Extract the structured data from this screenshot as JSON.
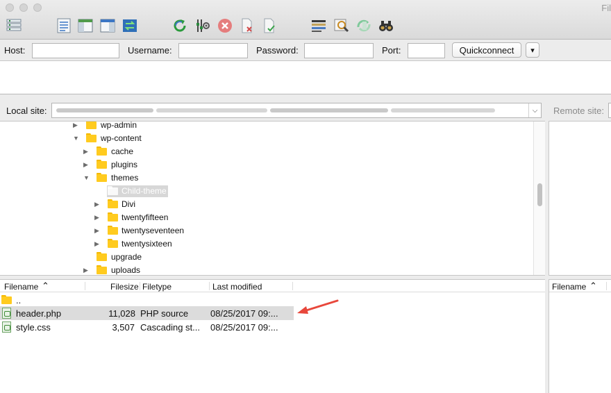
{
  "window": {
    "title": "Fil"
  },
  "toolbar": {
    "icons": [
      "site-manager-icon",
      "toggle-message-log-icon",
      "toggle-local-tree-icon",
      "toggle-remote-tree-icon",
      "toggle-queue-icon",
      "refresh-icon",
      "process-queue-icon",
      "cancel-icon",
      "disconnect-icon",
      "reconnect-icon",
      "filename-filters-icon",
      "compare-directories-icon",
      "sync-browsing-icon",
      "search-files-icon"
    ]
  },
  "quickconnect": {
    "host_label": "Host:",
    "username_label": "Username:",
    "password_label": "Password:",
    "port_label": "Port:",
    "host_value": "",
    "username_value": "",
    "password_value": "",
    "port_value": "",
    "button_label": "Quickconnect",
    "dropdown_glyph": "▾"
  },
  "local": {
    "label": "Local site:",
    "combo_arrow": "⌵"
  },
  "remote": {
    "label": "Remote site:"
  },
  "tree": {
    "items": [
      {
        "label": "wp-admin",
        "expander": "▶"
      },
      {
        "label": "wp-content",
        "expander": "▼"
      },
      {
        "label": "cache",
        "expander": "▶"
      },
      {
        "label": "plugins",
        "expander": "▶"
      },
      {
        "label": "themes",
        "expander": "▼"
      },
      {
        "label": "Child-theme",
        "expander": "",
        "selected": true
      },
      {
        "label": "Divi",
        "expander": "▶"
      },
      {
        "label": "twentyfifteen",
        "expander": "▶"
      },
      {
        "label": "twentyseventeen",
        "expander": "▶"
      },
      {
        "label": "twentysixteen",
        "expander": "▶"
      },
      {
        "label": "upgrade",
        "expander": ""
      },
      {
        "label": "uploads",
        "expander": "▶"
      }
    ]
  },
  "filelist": {
    "columns": {
      "filename": "Filename",
      "sort_glyph": "⌃",
      "filesize": "Filesize",
      "filetype": "Filetype",
      "last_modified": "Last modified"
    },
    "rows": [
      {
        "filename": "..",
        "filesize": "",
        "filetype": "",
        "last_modified": ""
      },
      {
        "filename": "header.php",
        "filesize": "11,028",
        "filetype": "PHP source",
        "last_modified": "08/25/2017 09:..."
      },
      {
        "filename": "style.css",
        "filesize": "3,507",
        "filetype": "Cascading st...",
        "last_modified": "08/25/2017 09:..."
      }
    ]
  },
  "remote_filelist": {
    "filename_header": "Filename",
    "sort_glyph": "⌃"
  },
  "colors": {
    "annotation_arrow": "#e8473b",
    "folder": "#ffcb1f",
    "selection": "#dcdcdc"
  }
}
